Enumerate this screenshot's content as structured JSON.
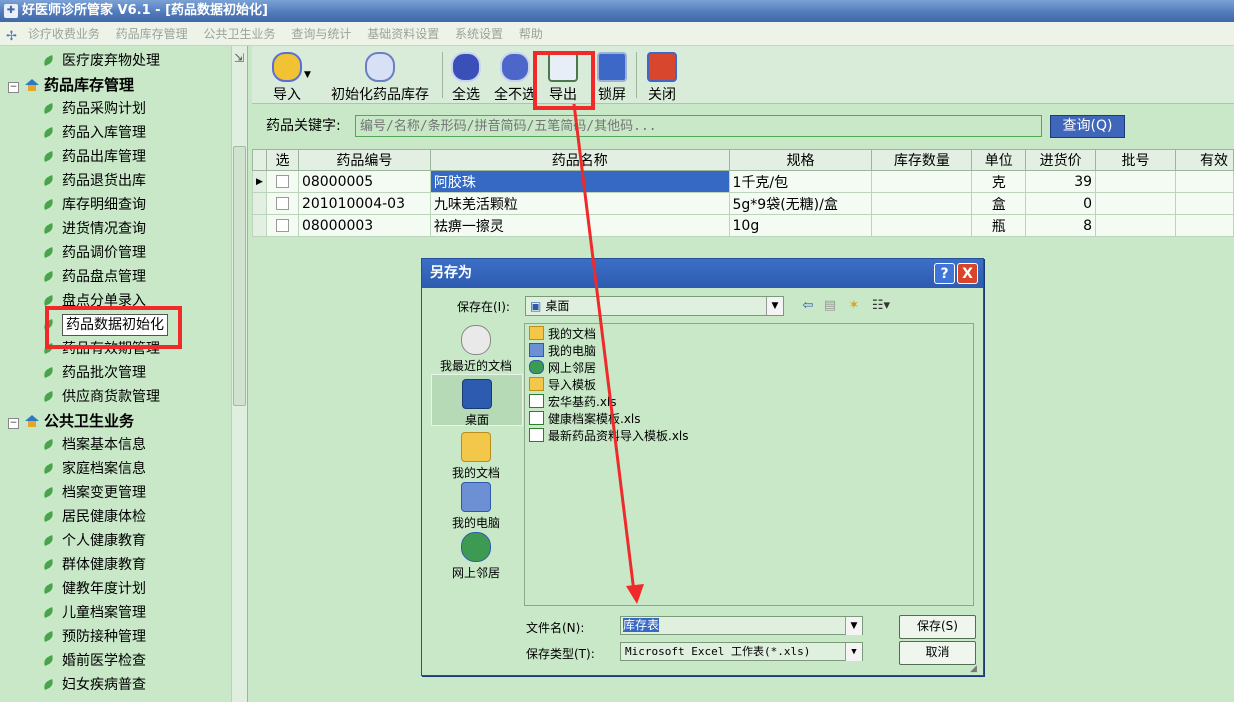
{
  "window": {
    "title": "好医师诊所管家 V6.1 - [药品数据初始化]"
  },
  "menu": [
    "诊疗收费业务",
    "药品库存管理",
    "公共卫生业务",
    "查询与统计",
    "基础资料设置",
    "系统设置",
    "帮助"
  ],
  "sidebar": {
    "items": [
      {
        "type": "leaf",
        "label": "医疗废弃物处理"
      },
      {
        "type": "group",
        "label": "药品库存管理"
      },
      {
        "type": "leaf",
        "label": "药品采购计划"
      },
      {
        "type": "leaf",
        "label": "药品入库管理"
      },
      {
        "type": "leaf",
        "label": "药品出库管理"
      },
      {
        "type": "leaf",
        "label": "药品退货出库"
      },
      {
        "type": "leaf",
        "label": "库存明细查询"
      },
      {
        "type": "leaf",
        "label": "进货情况查询"
      },
      {
        "type": "leaf",
        "label": "药品调价管理"
      },
      {
        "type": "leaf",
        "label": "药品盘点管理"
      },
      {
        "type": "leaf",
        "label": "盘点分单录入"
      },
      {
        "type": "leaf",
        "label": "药品数据初始化",
        "selected": true
      },
      {
        "type": "leaf",
        "label": "药品有效期管理"
      },
      {
        "type": "leaf",
        "label": "药品批次管理"
      },
      {
        "type": "leaf",
        "label": "供应商货款管理"
      },
      {
        "type": "group",
        "label": "公共卫生业务"
      },
      {
        "type": "leaf",
        "label": "档案基本信息"
      },
      {
        "type": "leaf",
        "label": "家庭档案信息"
      },
      {
        "type": "leaf",
        "label": "档案变更管理"
      },
      {
        "type": "leaf",
        "label": "居民健康体检"
      },
      {
        "type": "leaf",
        "label": "个人健康教育"
      },
      {
        "type": "leaf",
        "label": "群体健康教育"
      },
      {
        "type": "leaf",
        "label": "健教年度计划"
      },
      {
        "type": "leaf",
        "label": "儿童档案管理"
      },
      {
        "type": "leaf",
        "label": "预防接种管理"
      },
      {
        "type": "leaf",
        "label": "婚前医学检查"
      },
      {
        "type": "leaf",
        "label": "妇女疾病普查"
      }
    ]
  },
  "toolbar": {
    "import_label": "导入",
    "init_label": "初始化药品库存",
    "select_all_label": "全选",
    "deselect_all_label": "全不选",
    "export_label": "导出",
    "lock_label": "锁屏",
    "close_label": "关闭"
  },
  "search": {
    "label": "药品关键字:",
    "placeholder": "编号/名称/条形码/拼音简码/五笔简码/其他码...",
    "button_label": "查询(Q)"
  },
  "table": {
    "headers": [
      "选",
      "药品编号",
      "药品名称",
      "规格",
      "库存数量",
      "单位",
      "进货价",
      "批号",
      "有效"
    ],
    "rows": [
      {
        "code": "08000005",
        "name": "阿胶珠",
        "spec": "1千克/包",
        "qty": "",
        "unit": "克",
        "price": "39",
        "batch": ""
      },
      {
        "code": "201010004-03",
        "name": "九味羌活颗粒",
        "spec": "5g*9袋(无糖)/盒",
        "qty": "",
        "unit": "盒",
        "price": "0",
        "batch": ""
      },
      {
        "code": "08000003",
        "name": "祛痹一擦灵",
        "spec": "10g",
        "qty": "",
        "unit": "瓶",
        "price": "8",
        "batch": ""
      }
    ]
  },
  "dialog": {
    "title": "另存为",
    "help": "?",
    "close": "X",
    "save_in_label": "保存在(I):",
    "save_in_value": "桌面",
    "places": [
      "我最近的文档",
      "桌面",
      "我的文档",
      "我的电脑",
      "网上邻居"
    ],
    "files": [
      {
        "name": "我的文档",
        "kind": "folder"
      },
      {
        "name": "我的电脑",
        "kind": "computer"
      },
      {
        "name": "网上邻居",
        "kind": "network"
      },
      {
        "name": "导入模板",
        "kind": "folder"
      },
      {
        "name": "宏华基药.xls",
        "kind": "xls"
      },
      {
        "name": "健康档案模板.xls",
        "kind": "xls"
      },
      {
        "name": "最新药品资料导入模板.xls",
        "kind": "xls"
      }
    ],
    "filename_label": "文件名(N):",
    "filename_value": "库存表",
    "filetype_label": "保存类型(T):",
    "filetype_value": "Microsoft Excel 工作表(*.xls)",
    "save_button": "保存(S)",
    "cancel_button": "取消"
  },
  "colors": {
    "annotation": "#f02a2a",
    "panel": "#c8e8c8",
    "title_blue": "#3b6fc6"
  }
}
